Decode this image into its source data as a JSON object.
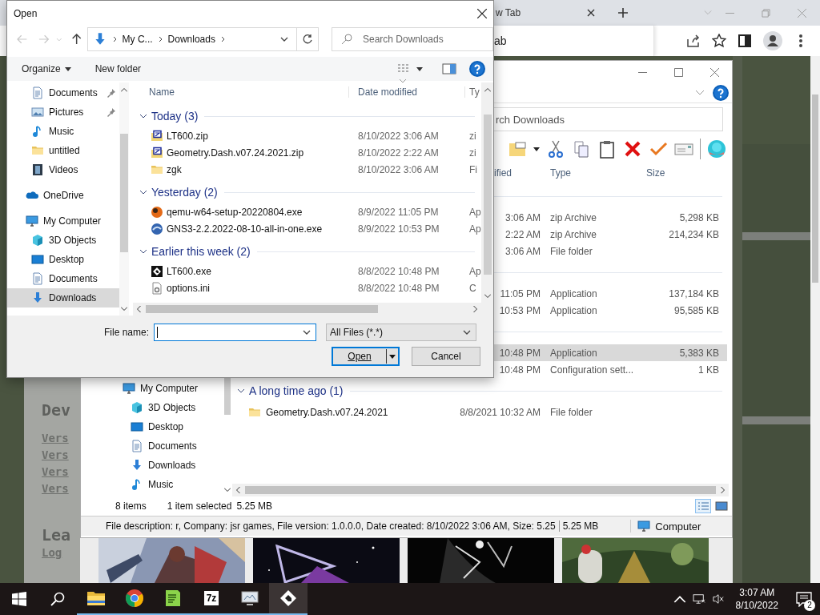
{
  "browser": {
    "tab_title": "w Tab",
    "omnibox_suggestion": "ab"
  },
  "webpage": {
    "heading": "Dev",
    "links": [
      "Vers",
      "Vers",
      "Vers",
      "Vers"
    ],
    "heading_2": "Lea",
    "link_2": "Log"
  },
  "explorer": {
    "search": {
      "placeholder": "rch Downloads"
    },
    "columns": [
      "ified",
      "Type",
      "Size"
    ],
    "nav_items": [
      {
        "label": "My Computer",
        "selected": false,
        "children": [
          {
            "label": "3D Objects",
            "selected": false
          },
          {
            "label": "Desktop",
            "selected": false
          },
          {
            "label": "Documents",
            "selected": false
          },
          {
            "label": "Downloads",
            "selected": false
          },
          {
            "label": "Music",
            "selected": false
          }
        ]
      }
    ],
    "groups": [
      {
        "rows": [
          {
            "date": "3:06 AM",
            "type": "zip Archive",
            "size": "5,298 KB",
            "selected": false
          },
          {
            "date": "2:22 AM",
            "type": "zip Archive",
            "size": "214,234 KB",
            "selected": false
          },
          {
            "date": "3:06 AM",
            "type": "File folder",
            "selected": false
          }
        ]
      },
      {
        "rows": [
          {
            "date": "11:05 PM",
            "type": "Application",
            "size": "137,184 KB",
            "selected": false
          },
          {
            "date": "10:53 PM",
            "type": "Application",
            "size": "95,585 KB",
            "selected": false
          }
        ]
      },
      {
        "rows": [
          {
            "date": "10:48 PM",
            "type": "Application",
            "size": "5,383 KB",
            "selected": true
          },
          {
            "date": "10:48 PM",
            "type": "Configuration sett...",
            "size": "1 KB",
            "selected": false
          }
        ]
      },
      {
        "label": "A long time ago (1)",
        "rows": [
          {
            "name": "Geometry.Dash.v07.24.2021",
            "date": "8/8/2021 10:32 AM",
            "type": "File folder",
            "selected": false
          }
        ]
      }
    ],
    "status": {
      "count": "8 items",
      "selection": "1 item selected",
      "size": "5.25 MB"
    },
    "details": {
      "description": "File description: r, Company: jsr games, File version: 1.0.0.0, Date created: 8/10/2022 3:06 AM, Size: 5.25",
      "size": "5.25 MB",
      "zone": "Computer"
    }
  },
  "open_dialog": {
    "title": "Open",
    "breadcrumb": [
      "My C...",
      "Downloads"
    ],
    "search": {
      "placeholder": "Search Downloads"
    },
    "commands": [
      "Organize",
      "New folder"
    ],
    "nav_sections": [
      [
        {
          "label": "Documents",
          "pinned": true,
          "selected": false
        },
        {
          "label": "Pictures",
          "pinned": true,
          "selected": false
        },
        {
          "label": "Music",
          "pinned": false,
          "selected": false
        },
        {
          "label": "untitled",
          "pinned": false,
          "selected": false
        },
        {
          "label": "Videos",
          "pinned": false,
          "selected": false
        }
      ],
      [
        {
          "label": "OneDrive",
          "selected": false
        }
      ],
      [
        {
          "label": "My Computer",
          "selected": false,
          "children": [
            {
              "label": "3D Objects",
              "selected": false
            },
            {
              "label": "Desktop",
              "selected": false
            },
            {
              "label": "Documents",
              "selected": false
            },
            {
              "label": "Downloads",
              "selected": true
            }
          ]
        }
      ]
    ],
    "columns": [
      "Name",
      "Date modified",
      "Ty"
    ],
    "groups": [
      {
        "label": "Today (3)",
        "rows": [
          {
            "name": "LT600.zip",
            "date": "8/10/2022 3:06 AM",
            "type": "zi"
          },
          {
            "name": "Geometry.Dash.v07.24.2021.zip",
            "date": "8/10/2022 2:22 AM",
            "type": "zi"
          },
          {
            "name": "zgk",
            "date": "8/10/2022 3:06 AM",
            "type": "Fi"
          }
        ]
      },
      {
        "label": "Yesterday (2)",
        "rows": [
          {
            "name": "qemu-w64-setup-20220804.exe",
            "date": "8/9/2022 11:05 PM",
            "type": "Ap"
          },
          {
            "name": "GNS3-2.2.2022-08-10-all-in-one.exe",
            "date": "8/9/2022 10:53 PM",
            "type": "Ap"
          }
        ]
      },
      {
        "label": "Earlier this week (2)",
        "rows": [
          {
            "name": "LT600.exe",
            "date": "8/8/2022 10:48 PM",
            "type": "Ap"
          },
          {
            "name": "options.ini",
            "date": "8/8/2022 10:48 PM",
            "type": "C"
          }
        ]
      }
    ],
    "file_name": {
      "label": "File name:"
    },
    "filter": "All Files (*.*)",
    "buttons": [
      {
        "label": "Open",
        "default": true
      },
      {
        "label": "Cancel",
        "default": false
      }
    ]
  },
  "taskbar": {
    "apps": [
      {
        "kind": "folder",
        "selected": false
      },
      {
        "kind": "chrome",
        "selected": false
      },
      {
        "kind": "notepad",
        "selected": false
      },
      {
        "kind": "archiver",
        "label": "7z",
        "selected": false
      },
      {
        "kind": "monitor",
        "selected": false
      },
      {
        "kind": "game",
        "selected": true
      }
    ],
    "time": "3:07 AM",
    "date": "8/10/2022",
    "notification_count": "2"
  }
}
